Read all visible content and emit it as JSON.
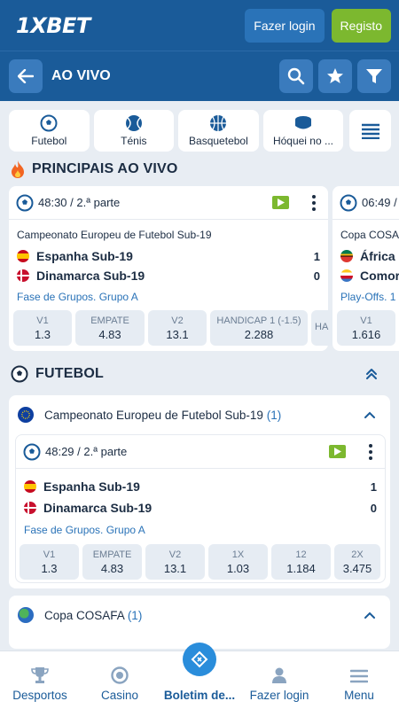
{
  "header": {
    "logo": "1XBET",
    "login_label": "Fazer login",
    "register_label": "Registo"
  },
  "live_bar": {
    "title": "AO VIVO"
  },
  "sports": [
    {
      "label": "Futebol",
      "icon": "soccer-ball-icon"
    },
    {
      "label": "Ténis",
      "icon": "tennis-ball-icon"
    },
    {
      "label": "Basquetebol",
      "icon": "basketball-icon"
    },
    {
      "label": "Hóquei no ...",
      "icon": "hockey-puck-icon"
    }
  ],
  "top_live": {
    "heading": "PRINCIPAIS AO VIVO",
    "cards": [
      {
        "time": "48:30 / 2.ª parte",
        "competition": "Campeonato Europeu de Futebol Sub-19",
        "team1": "Espanha Sub-19",
        "score1": "1",
        "team2": "Dinamarca Sub-19",
        "score2": "0",
        "stage": "Fase de Grupos. Grupo A",
        "odds": [
          {
            "k": "V1",
            "v": "1.3"
          },
          {
            "k": "EMPATE",
            "v": "4.83"
          },
          {
            "k": "V2",
            "v": "13.1"
          },
          {
            "k": "HANDICAP 1 (-1.5)",
            "v": "2.288"
          },
          {
            "k": "HA",
            "v": ""
          }
        ]
      },
      {
        "time": "06:49 /",
        "competition": "Copa COSAF",
        "team1": "África",
        "score1": "",
        "team2": "Comor",
        "score2": "",
        "stage": "Play-Offs. 1",
        "odds": [
          {
            "k": "V1",
            "v": "1.616"
          }
        ]
      }
    ]
  },
  "futebol": {
    "heading": "FUTEBOL",
    "competitions": [
      {
        "name": "Campeonato Europeu de Futebol Sub-19",
        "count": "(1)"
      },
      {
        "name": "Copa COSAFA",
        "count": "(1)"
      }
    ],
    "event": {
      "time": "48:29 / 2.ª parte",
      "team1": "Espanha Sub-19",
      "score1": "1",
      "team2": "Dinamarca Sub-19",
      "score2": "0",
      "stage": "Fase de Grupos. Grupo A",
      "odds": [
        {
          "k": "V1",
          "v": "1.3"
        },
        {
          "k": "EMPATE",
          "v": "4.83"
        },
        {
          "k": "V2",
          "v": "13.1"
        },
        {
          "k": "1X",
          "v": "1.03"
        },
        {
          "k": "12",
          "v": "1.184"
        },
        {
          "k": "2X",
          "v": "3.475"
        }
      ]
    }
  },
  "bottom_nav": [
    {
      "label": "Desportos",
      "icon": "trophy-icon"
    },
    {
      "label": "Casino",
      "icon": "casino-chip-icon"
    },
    {
      "label": "Boletim de...",
      "icon": "bet-slip-icon"
    },
    {
      "label": "Fazer login",
      "icon": "user-icon"
    },
    {
      "label": "Menu",
      "icon": "menu-icon"
    }
  ],
  "colors": {
    "primary": "#1a5b99",
    "accent_green": "#7cb82f",
    "link_blue": "#2a73b8"
  }
}
